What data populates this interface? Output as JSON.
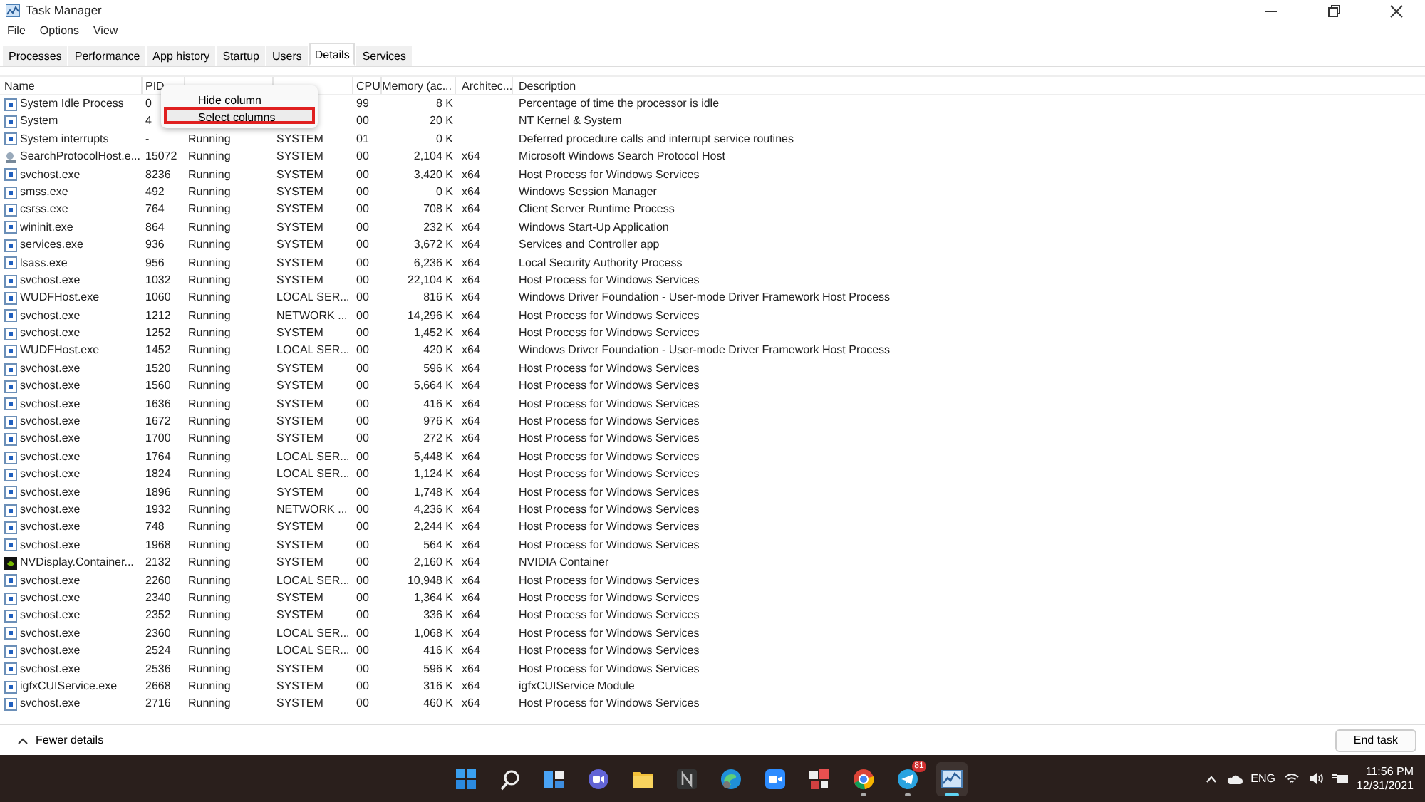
{
  "window": {
    "title": "Task Manager"
  },
  "menu": [
    "File",
    "Options",
    "View"
  ],
  "tabs": [
    {
      "label": "Processes",
      "selected": false
    },
    {
      "label": "Performance",
      "selected": false
    },
    {
      "label": "App history",
      "selected": false
    },
    {
      "label": "Startup",
      "selected": false
    },
    {
      "label": "Users",
      "selected": false
    },
    {
      "label": "Details",
      "selected": true
    },
    {
      "label": "Services",
      "selected": false
    }
  ],
  "table": {
    "columns": {
      "name": "Name",
      "pid": "PID",
      "cpu": "CPU",
      "memory": "Memory (ac...",
      "arch": "Architec...",
      "description": "Description"
    },
    "rows": [
      {
        "kind": "service",
        "name": "System Idle Process",
        "pid": "0",
        "cpu": "99",
        "memory": "8 K",
        "description": "Percentage of time the processor is idle"
      },
      {
        "kind": "service",
        "name": "System",
        "pid": "4",
        "cpu": "00",
        "memory": "20 K",
        "description": "NT Kernel & System"
      },
      {
        "kind": "service",
        "name": "System interrupts",
        "pid": "-",
        "status": "Running",
        "user": "SYSTEM",
        "cpu": "01",
        "memory": "0 K",
        "description": "Deferred procedure calls and interrupt service routines"
      },
      {
        "kind": "search",
        "name": "SearchProtocolHost.e...",
        "pid": "15072",
        "status": "Running",
        "user": "SYSTEM",
        "cpu": "00",
        "memory": "2,104 K",
        "arch": "x64",
        "description": "Microsoft Windows Search Protocol Host"
      },
      {
        "kind": "service",
        "name": "svchost.exe",
        "pid": "8236",
        "status": "Running",
        "user": "SYSTEM",
        "cpu": "00",
        "memory": "3,420 K",
        "arch": "x64",
        "description": "Host Process for Windows Services"
      },
      {
        "kind": "service",
        "name": "smss.exe",
        "pid": "492",
        "status": "Running",
        "user": "SYSTEM",
        "cpu": "00",
        "memory": "0 K",
        "arch": "x64",
        "description": "Windows Session Manager"
      },
      {
        "kind": "service",
        "name": "csrss.exe",
        "pid": "764",
        "status": "Running",
        "user": "SYSTEM",
        "cpu": "00",
        "memory": "708 K",
        "arch": "x64",
        "description": "Client Server Runtime Process"
      },
      {
        "kind": "service",
        "name": "wininit.exe",
        "pid": "864",
        "status": "Running",
        "user": "SYSTEM",
        "cpu": "00",
        "memory": "232 K",
        "arch": "x64",
        "description": "Windows Start-Up Application"
      },
      {
        "kind": "service",
        "name": "services.exe",
        "pid": "936",
        "status": "Running",
        "user": "SYSTEM",
        "cpu": "00",
        "memory": "3,672 K",
        "arch": "x64",
        "description": "Services and Controller app"
      },
      {
        "kind": "service",
        "name": "lsass.exe",
        "pid": "956",
        "status": "Running",
        "user": "SYSTEM",
        "cpu": "00",
        "memory": "6,236 K",
        "arch": "x64",
        "description": "Local Security Authority Process"
      },
      {
        "kind": "service",
        "name": "svchost.exe",
        "pid": "1032",
        "status": "Running",
        "user": "SYSTEM",
        "cpu": "00",
        "memory": "22,104 K",
        "arch": "x64",
        "description": "Host Process for Windows Services"
      },
      {
        "kind": "service",
        "name": "WUDFHost.exe",
        "pid": "1060",
        "status": "Running",
        "user": "LOCAL SER...",
        "cpu": "00",
        "memory": "816 K",
        "arch": "x64",
        "description": "Windows Driver Foundation - User-mode Driver Framework Host Process"
      },
      {
        "kind": "service",
        "name": "svchost.exe",
        "pid": "1212",
        "status": "Running",
        "user": "NETWORK ...",
        "cpu": "00",
        "memory": "14,296 K",
        "arch": "x64",
        "description": "Host Process for Windows Services"
      },
      {
        "kind": "service",
        "name": "svchost.exe",
        "pid": "1252",
        "status": "Running",
        "user": "SYSTEM",
        "cpu": "00",
        "memory": "1,452 K",
        "arch": "x64",
        "description": "Host Process for Windows Services"
      },
      {
        "kind": "service",
        "name": "WUDFHost.exe",
        "pid": "1452",
        "status": "Running",
        "user": "LOCAL SER...",
        "cpu": "00",
        "memory": "420 K",
        "arch": "x64",
        "description": "Windows Driver Foundation - User-mode Driver Framework Host Process"
      },
      {
        "kind": "service",
        "name": "svchost.exe",
        "pid": "1520",
        "status": "Running",
        "user": "SYSTEM",
        "cpu": "00",
        "memory": "596 K",
        "arch": "x64",
        "description": "Host Process for Windows Services"
      },
      {
        "kind": "service",
        "name": "svchost.exe",
        "pid": "1560",
        "status": "Running",
        "user": "SYSTEM",
        "cpu": "00",
        "memory": "5,664 K",
        "arch": "x64",
        "description": "Host Process for Windows Services"
      },
      {
        "kind": "service",
        "name": "svchost.exe",
        "pid": "1636",
        "status": "Running",
        "user": "SYSTEM",
        "cpu": "00",
        "memory": "416 K",
        "arch": "x64",
        "description": "Host Process for Windows Services"
      },
      {
        "kind": "service",
        "name": "svchost.exe",
        "pid": "1672",
        "status": "Running",
        "user": "SYSTEM",
        "cpu": "00",
        "memory": "976 K",
        "arch": "x64",
        "description": "Host Process for Windows Services"
      },
      {
        "kind": "service",
        "name": "svchost.exe",
        "pid": "1700",
        "status": "Running",
        "user": "SYSTEM",
        "cpu": "00",
        "memory": "272 K",
        "arch": "x64",
        "description": "Host Process for Windows Services"
      },
      {
        "kind": "service",
        "name": "svchost.exe",
        "pid": "1764",
        "status": "Running",
        "user": "LOCAL SER...",
        "cpu": "00",
        "memory": "5,448 K",
        "arch": "x64",
        "description": "Host Process for Windows Services"
      },
      {
        "kind": "service",
        "name": "svchost.exe",
        "pid": "1824",
        "status": "Running",
        "user": "LOCAL SER...",
        "cpu": "00",
        "memory": "1,124 K",
        "arch": "x64",
        "description": "Host Process for Windows Services"
      },
      {
        "kind": "service",
        "name": "svchost.exe",
        "pid": "1896",
        "status": "Running",
        "user": "SYSTEM",
        "cpu": "00",
        "memory": "1,748 K",
        "arch": "x64",
        "description": "Host Process for Windows Services"
      },
      {
        "kind": "service",
        "name": "svchost.exe",
        "pid": "1932",
        "status": "Running",
        "user": "NETWORK ...",
        "cpu": "00",
        "memory": "4,236 K",
        "arch": "x64",
        "description": "Host Process for Windows Services"
      },
      {
        "kind": "service",
        "name": "svchost.exe",
        "pid": "748",
        "status": "Running",
        "user": "SYSTEM",
        "cpu": "00",
        "memory": "2,244 K",
        "arch": "x64",
        "description": "Host Process for Windows Services"
      },
      {
        "kind": "service",
        "name": "svchost.exe",
        "pid": "1968",
        "status": "Running",
        "user": "SYSTEM",
        "cpu": "00",
        "memory": "564 K",
        "arch": "x64",
        "description": "Host Process for Windows Services"
      },
      {
        "kind": "nvidia",
        "name": "NVDisplay.Container...",
        "pid": "2132",
        "status": "Running",
        "user": "SYSTEM",
        "cpu": "00",
        "memory": "2,160 K",
        "arch": "x64",
        "description": "NVIDIA Container"
      },
      {
        "kind": "service",
        "name": "svchost.exe",
        "pid": "2260",
        "status": "Running",
        "user": "LOCAL SER...",
        "cpu": "00",
        "memory": "10,948 K",
        "arch": "x64",
        "description": "Host Process for Windows Services"
      },
      {
        "kind": "service",
        "name": "svchost.exe",
        "pid": "2340",
        "status": "Running",
        "user": "SYSTEM",
        "cpu": "00",
        "memory": "1,364 K",
        "arch": "x64",
        "description": "Host Process for Windows Services"
      },
      {
        "kind": "service",
        "name": "svchost.exe",
        "pid": "2352",
        "status": "Running",
        "user": "SYSTEM",
        "cpu": "00",
        "memory": "336 K",
        "arch": "x64",
        "description": "Host Process for Windows Services"
      },
      {
        "kind": "service",
        "name": "svchost.exe",
        "pid": "2360",
        "status": "Running",
        "user": "LOCAL SER...",
        "cpu": "00",
        "memory": "1,068 K",
        "arch": "x64",
        "description": "Host Process for Windows Services"
      },
      {
        "kind": "service",
        "name": "svchost.exe",
        "pid": "2524",
        "status": "Running",
        "user": "LOCAL SER...",
        "cpu": "00",
        "memory": "416 K",
        "arch": "x64",
        "description": "Host Process for Windows Services"
      },
      {
        "kind": "service",
        "name": "svchost.exe",
        "pid": "2536",
        "status": "Running",
        "user": "SYSTEM",
        "cpu": "00",
        "memory": "596 K",
        "arch": "x64",
        "description": "Host Process for Windows Services"
      },
      {
        "kind": "service",
        "name": "igfxCUIService.exe",
        "pid": "2668",
        "status": "Running",
        "user": "SYSTEM",
        "cpu": "00",
        "memory": "316 K",
        "arch": "x64",
        "description": "igfxCUIService Module"
      },
      {
        "kind": "service",
        "name": "svchost.exe",
        "pid": "2716",
        "status": "Running",
        "user": "SYSTEM",
        "cpu": "00",
        "memory": "460 K",
        "arch": "x64",
        "description": "Host Process for Windows Services"
      }
    ]
  },
  "context_menu": [
    {
      "label": "Hide column",
      "highlighted": false
    },
    {
      "label": "Select columns",
      "highlighted": true
    }
  ],
  "footer": {
    "toggle": "Fewer details",
    "button": "End task"
  },
  "taskbar": {
    "apps": [
      {
        "kind": "start",
        "running": false,
        "active": false
      },
      {
        "kind": "search",
        "running": false,
        "active": false
      },
      {
        "kind": "widgets",
        "running": false,
        "active": false
      },
      {
        "kind": "chat",
        "running": false,
        "active": false
      },
      {
        "kind": "folder",
        "running": false,
        "active": false
      },
      {
        "kind": "notes",
        "running": false,
        "active": false
      },
      {
        "kind": "browser",
        "running": false,
        "active": false
      },
      {
        "kind": "video",
        "running": false,
        "active": false
      },
      {
        "kind": "tiles",
        "running": false,
        "active": false
      },
      {
        "kind": "chrome",
        "running": true,
        "active": false
      },
      {
        "kind": "messenger",
        "running": true,
        "active": false,
        "badge": "81"
      },
      {
        "kind": "monitor",
        "running": true,
        "active": true
      }
    ],
    "language": "ENG",
    "time": "11:56 PM",
    "date": "12/31/2021"
  }
}
